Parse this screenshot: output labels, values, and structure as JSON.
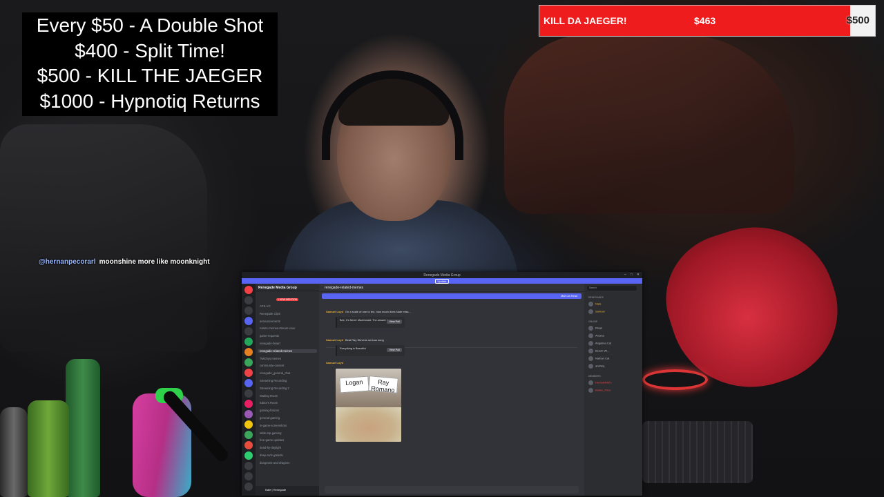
{
  "overlay": {
    "goals": [
      "Every $50 - A Double Shot",
      "$400 - Split Time!",
      "$500 - KILL THE JAEGER",
      "$1000 - Hypnotiq Returns"
    ],
    "donation_bar": {
      "title": "KILL DA JAEGER!",
      "current": "$463",
      "goal": "$500",
      "progress_fraction": 0.926,
      "fill_color": "#ee1c1c",
      "track_color": "#f2f2f2"
    },
    "chat": {
      "username": "@hernanpecorarl",
      "message": "moonshine more like moonknight"
    }
  },
  "discord": {
    "window_title": "Renegade Media Group",
    "banner": {
      "button": "Update"
    },
    "server_name": "Renegade Media Group",
    "boost_badge": "1 NEW MENTION",
    "channels": [
      "APK-VC",
      "Renegade Clips",
      "announcements",
      "nature-memes-stream-cove",
      "game-requests",
      "renegade-fanart",
      "renegade-related-memes",
      "Twitchys memes",
      "community-content",
      "renegade_general_chat",
      "Streaming Recording",
      "Streaming Recording 2",
      "Waiting Room",
      "Editor's Room",
      "gaming-forums",
      "general-gaming",
      "in-game-screenshots",
      "table-top-gaming",
      "free-game-updates",
      "dead-by-daylight",
      "deep-rock-galactic",
      "dungeons-and-dragons"
    ],
    "active_channel": "renegade-related-memes",
    "channel_header": "renegade-related-memes",
    "new_messages_bar": "Mark As Read",
    "messages": [
      {
        "author": "Samuel Loyd",
        "text": "On a scale of one to ten, how much does Nate miss...",
        "embed": "Bee, It's Never MacDonald: The answer is...",
        "button": "View Poll"
      },
      {
        "author": "Samuel Loyd",
        "text": "Beat Ray Stevens serious song",
        "embed": "Everything is Beautiful",
        "button": "View Poll"
      },
      {
        "author": "Samuel Loyd",
        "text": ""
      }
    ],
    "meme": {
      "card_left": "Logan",
      "card_right": "Ray Romano"
    },
    "user_panel": "Nate | Renegade",
    "members": {
      "search_placeholder": "Search",
      "groups": [
        {
          "heading": "Renegades",
          "names": [
            "Nate",
            "Samuel"
          ]
        },
        {
          "heading": "Online",
          "names": [
            "Rivas",
            "Arcana",
            "Angelina Cat",
            "Beech Wi...",
            "Nathan Cat",
            "andreiq"
          ]
        },
        {
          "heading": "Members",
          "names": [
            "HerbalsR8Zn",
            "Bailee_Price"
          ]
        }
      ]
    }
  }
}
